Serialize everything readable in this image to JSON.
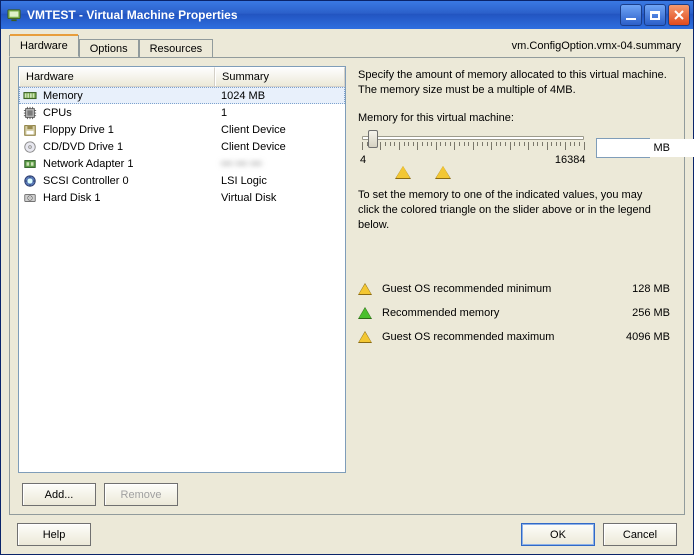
{
  "window": {
    "title_prefix": "VMTEST",
    "title_sep": " - ",
    "title_main": "Virtual Machine Properties"
  },
  "config_label": "vm.ConfigOption.vmx-04.summary",
  "tabs": [
    {
      "label": "Hardware",
      "active": true
    },
    {
      "label": "Options",
      "active": false
    },
    {
      "label": "Resources",
      "active": false
    }
  ],
  "list": {
    "col_hardware": "Hardware",
    "col_summary": "Summary",
    "rows": [
      {
        "icon": "memory-icon",
        "hw": "Memory",
        "sum": "1024 MB",
        "selected": true
      },
      {
        "icon": "cpu-icon",
        "hw": "CPUs",
        "sum": "1",
        "selected": false
      },
      {
        "icon": "floppy-icon",
        "hw": "Floppy Drive 1",
        "sum": "Client Device",
        "selected": false
      },
      {
        "icon": "cd-icon",
        "hw": "CD/DVD Drive 1",
        "sum": "Client Device",
        "selected": false
      },
      {
        "icon": "nic-icon",
        "hw": "Network Adapter 1",
        "sum": "••• ••• •••",
        "selected": false,
        "blur": true
      },
      {
        "icon": "scsi-icon",
        "hw": "SCSI Controller 0",
        "sum": "LSI Logic",
        "selected": false
      },
      {
        "icon": "disk-icon",
        "hw": "Hard Disk 1",
        "sum": "Virtual Disk",
        "selected": false
      }
    ]
  },
  "buttons": {
    "add": "Add...",
    "remove": "Remove",
    "help": "Help",
    "ok": "OK",
    "cancel": "Cancel"
  },
  "memory": {
    "description": "Specify the amount of memory allocated to this virtual machine. The memory size must be a multiple of 4MB.",
    "label": "Memory for this virtual machine:",
    "value": "1024",
    "unit": "MB",
    "min_label": "4",
    "max_label": "16384",
    "hint": "To set the memory to one of the indicated values, you may click the colored triangle on the slider above or in the legend below.",
    "legend": [
      {
        "color": "yellow",
        "label": "Guest OS recommended minimum",
        "value": "128 MB"
      },
      {
        "color": "green",
        "label": "Recommended memory",
        "value": "256 MB"
      },
      {
        "color": "yellow",
        "label": "Guest OS recommended maximum",
        "value": "4096 MB"
      }
    ]
  }
}
